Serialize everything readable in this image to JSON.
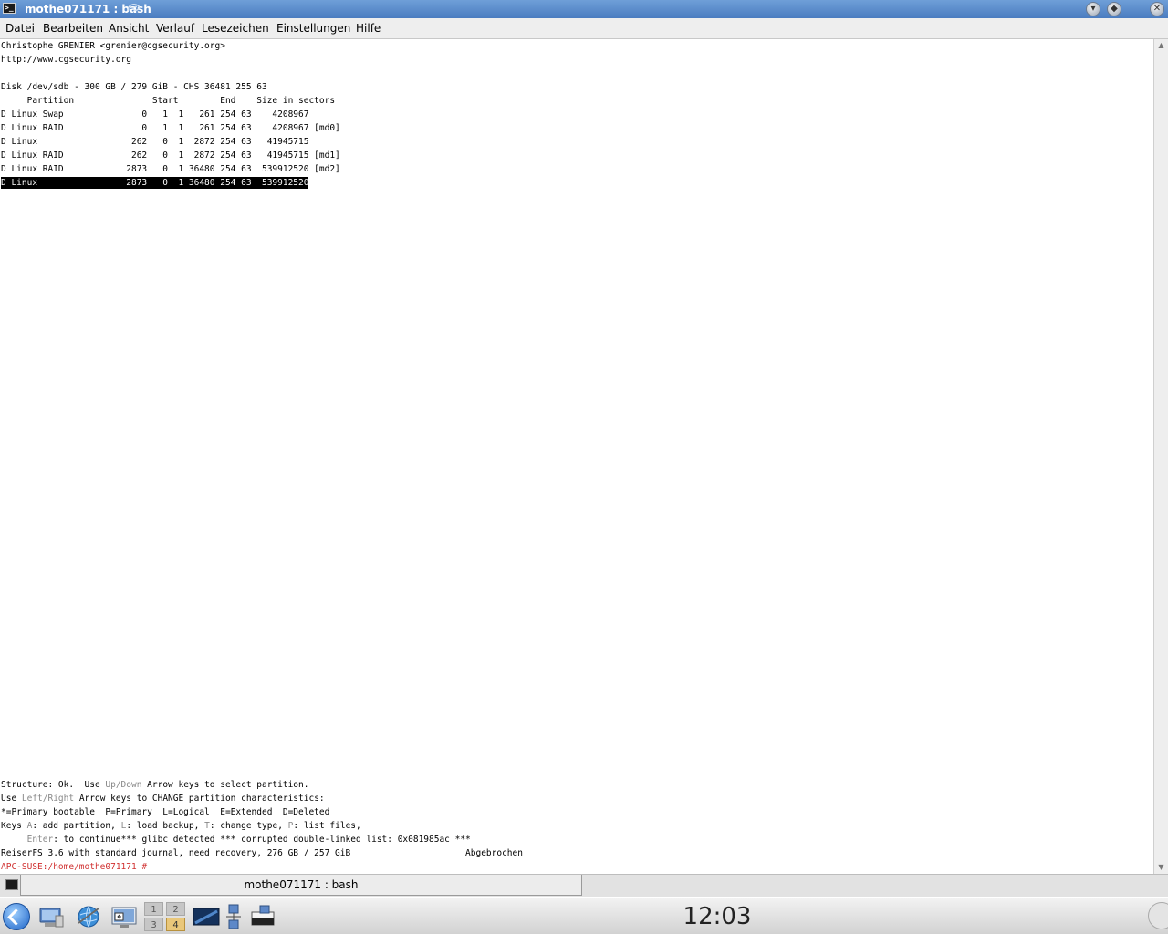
{
  "window": {
    "title": "mothe071171 : bash"
  },
  "menu": [
    "Datei",
    "Bearbeiten",
    "Ansicht",
    "Verlauf",
    "Lesezeichen",
    "Einstellungen",
    "Hilfe"
  ],
  "terminal": {
    "header": [
      "Christophe GRENIER <grenier@cgsecurity.org>",
      "http://www.cgsecurity.org"
    ],
    "disk_line": "Disk /dev/sdb - 300 GB / 279 GiB - CHS 36481 255 63",
    "table_header": "     Partition               Start        End    Size in sectors",
    "rows": [
      "D Linux Swap               0   1  1   261 254 63    4208967",
      "D Linux RAID               0   1  1   261 254 63    4208967 [md0]",
      "D Linux                  262   0  1  2872 254 63   41945715",
      "D Linux RAID             262   0  1  2872 254 63   41945715 [md1]",
      "D Linux RAID            2873   0  1 36480 254 63  539912520 [md2]",
      "D Linux                 2873   0  1 36480 254 63  539912520"
    ],
    "selected_row_index": 5,
    "footer": {
      "l1a": "Structure: Ok.  Use ",
      "l1b": "Up/Down",
      "l1c": " Arrow keys to select partition.",
      "l2a": "Use ",
      "l2b": "Left/Right",
      "l2c": " Arrow keys to CHANGE partition characteristics:",
      "l3": "*=Primary bootable  P=Primary  L=Logical  E=Extended  D=Deleted",
      "l4a": "Keys ",
      "l4b": "A",
      "l4c": ": add partition, ",
      "l4d": "L",
      "l4e": ": load backup, ",
      "l4f": "T",
      "l4g": ": change type, ",
      "l4h": "P",
      "l4i": ": list files,",
      "l5a": "     ",
      "l5b": "Enter",
      "l5c": ": to continue*** glibc detected *** corrupted double-linked list: 0x081985ac ***",
      "l6": "ReiserFS 3.6 with standard journal, need recovery, 276 GB / 257 GiB                      Abgebrochen",
      "prompt": "APC-SUSE:/home/mothe071171 #"
    }
  },
  "session_tab": {
    "label": "mothe071171 : bash"
  },
  "panel": {
    "pager": [
      "1",
      "2",
      "3",
      "4"
    ],
    "active_desktop": "4",
    "clock": "12:03"
  },
  "colors": {
    "titlebar": "#4a7cc0",
    "prompt": "#d03030",
    "highlight_bg": "#000000"
  }
}
